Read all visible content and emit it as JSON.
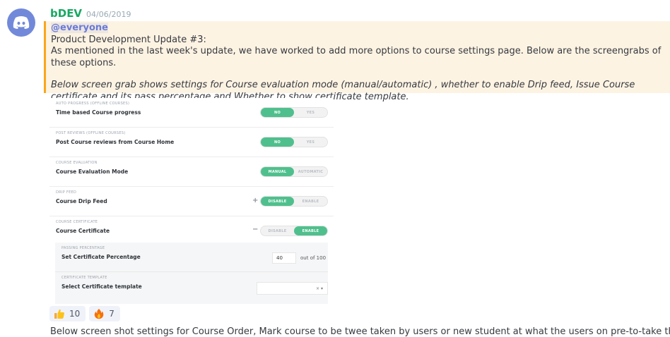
{
  "message": {
    "author": "bDEV",
    "timestamp": "04/06/2019",
    "mention": "@everyone",
    "title_line": "Product Development Update #3:",
    "body_line": "As mentioned in the last week's update, we have worked to add more options to course settings page.  Below are the screengrabs of these options.",
    "italic_line": "Below screen grab shows settings for Course evaluation mode (manual/automatic) , whether to enable Drip feed, Issue Course certificate and its pass percentage and Whether to show certificate template.",
    "cut_line": "Below screen shot settings for Course Order, Mark course to be twee taken by users or new student at what the users on pre-to-take them.",
    "accent": "#faa61a",
    "author_color": "#17a862"
  },
  "screenshot": {
    "rows": [
      {
        "caption": "AUTO PROGRESS (OFFLINE COURSES)",
        "title": "Time based Course progress",
        "options": [
          "NO",
          "YES"
        ],
        "active": 0,
        "prefix": ""
      },
      {
        "caption": "POST REVIEWS (OFFLINE COURSES)",
        "title": "Post Course reviews from Course Home",
        "options": [
          "NO",
          "YES"
        ],
        "active": 0,
        "prefix": ""
      },
      {
        "caption": "COURSE EVALUATION",
        "title": "Course Evaluation Mode",
        "options": [
          "MANUAL",
          "AUTOMATIC"
        ],
        "active": 0,
        "prefix": ""
      },
      {
        "caption": "DRIP FEED",
        "title": "Course Drip Feed",
        "options": [
          "DISABLE",
          "ENABLE"
        ],
        "active": 0,
        "prefix": "+"
      },
      {
        "caption": "COURSE CERTIFICATE",
        "title": "Course Certificate",
        "options": [
          "DISABLE",
          "ENABLE"
        ],
        "active": 1,
        "prefix": "−"
      }
    ],
    "passing": {
      "caption": "PASSING PERCENTAGE",
      "title": "Set Certificate Percentage",
      "value": "40",
      "suffix": "out of 100"
    },
    "template": {
      "caption": "CERTIFICATE TEMPLATE",
      "title": "Select Certificate template",
      "value": "× ▾"
    }
  },
  "reactions": [
    {
      "icon": "thumbs-up-icon",
      "count": "10"
    },
    {
      "icon": "fire-icon",
      "count": "7"
    }
  ]
}
